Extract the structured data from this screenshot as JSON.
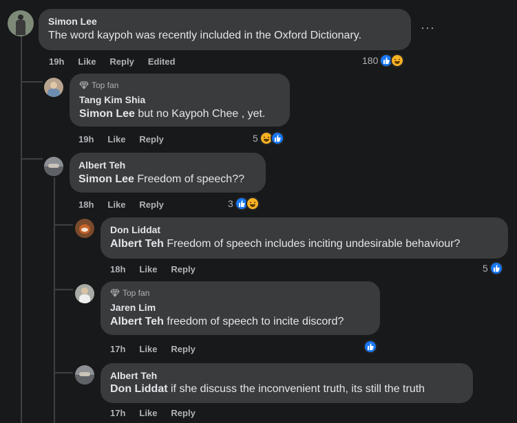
{
  "comments": [
    {
      "author": "Simon Lee",
      "mention": "",
      "text": "The word kaypoh was recently included in the Oxford Dictionary.",
      "time": "19h",
      "like": "Like",
      "reply": "Reply",
      "edited": "Edited",
      "reaction_count": "180",
      "reactions": [
        "like-icon",
        "haha-icon"
      ],
      "top_fan": ""
    },
    {
      "author": "Tang Kim Shia",
      "mention": "Simon Lee",
      "text": " but no Kaypoh Chee , yet.",
      "time": "19h",
      "like": "Like",
      "reply": "Reply",
      "reaction_count": "5",
      "reactions": [
        "haha-icon",
        "like-icon"
      ],
      "top_fan": "Top fan"
    },
    {
      "author": "Albert Teh",
      "mention": "Simon Lee",
      "text": " Freedom of speech??",
      "time": "18h",
      "like": "Like",
      "reply": "Reply",
      "reaction_count": "3",
      "reactions": [
        "like-icon",
        "haha-icon"
      ],
      "top_fan": ""
    },
    {
      "author": "Don Liddat",
      "mention": "Albert Teh",
      "text": " Freedom of speech includes inciting undesirable behaviour?",
      "time": "18h",
      "like": "Like",
      "reply": "Reply",
      "reaction_count": "5",
      "reactions": [
        "like-icon"
      ],
      "top_fan": ""
    },
    {
      "author": "Jaren Lim",
      "mention": "Albert Teh",
      "text": " freedom of speech to incite discord?",
      "time": "17h",
      "like": "Like",
      "reply": "Reply",
      "reaction_count": "",
      "reactions": [
        "like-icon"
      ],
      "top_fan": "Top fan"
    },
    {
      "author": "Albert Teh",
      "mention": "Don Liddat",
      "text": " if she discuss the inconvenient truth, its still the truth",
      "time": "17h",
      "like": "Like",
      "reply": "Reply",
      "reaction_count": "",
      "reactions": [],
      "top_fan": ""
    }
  ],
  "more_options": "···",
  "colors": {
    "like": "#1877f2",
    "haha": "#f7b125",
    "bubble": "#3a3b3c",
    "background": "#18191a"
  }
}
